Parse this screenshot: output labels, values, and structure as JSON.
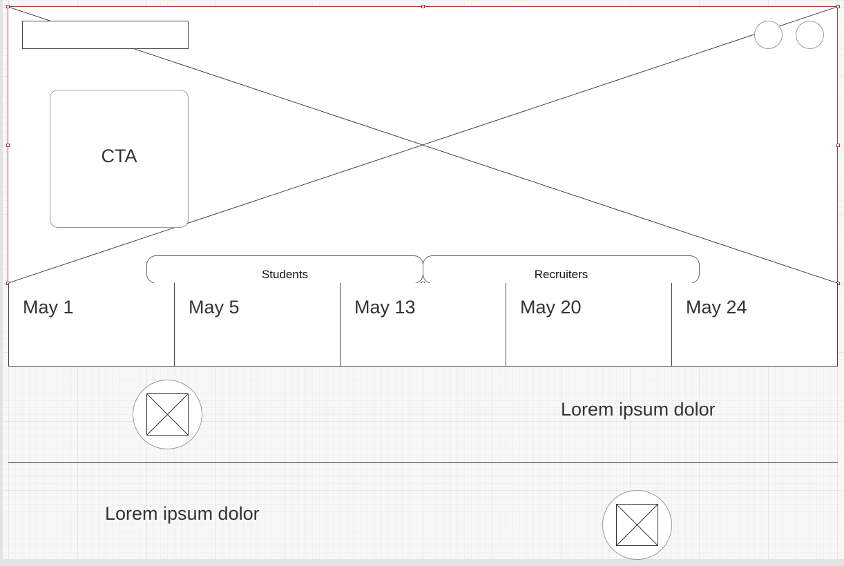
{
  "hero": {
    "cta_label": "CTA",
    "tabs": [
      {
        "label": "Students"
      },
      {
        "label": "Recruiters"
      }
    ]
  },
  "dates": [
    "May 1",
    "May 5",
    "May 13",
    "May 20",
    "May 24"
  ],
  "sections": [
    {
      "text": "Lorem ipsum dolor"
    },
    {
      "text": "Lorem ipsum dolor"
    }
  ],
  "colors": {
    "selection_outline": "#b03a2e",
    "grid": "#e6e6e6"
  },
  "icons": {
    "hero": "image-placeholder-icon",
    "section": "image-placeholder-icon",
    "header_buttons": "circle-icon"
  }
}
